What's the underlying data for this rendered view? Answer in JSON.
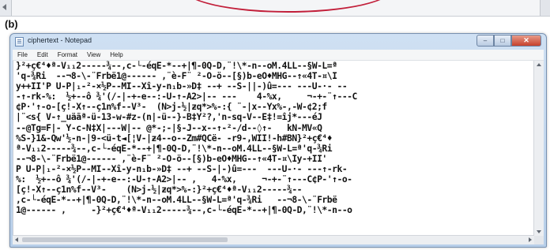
{
  "figure_label": "(b)",
  "window": {
    "title": "ciphertext - Notepad",
    "buttons": {
      "minimize": "–",
      "maximize": "□",
      "close": "✕"
    }
  },
  "menu": [
    "File",
    "Edit",
    "Format",
    "View",
    "Help"
  ],
  "content_lines": [
    "}²+ç€⁴♦ª-V₁₁2-----¾--,c-└-éqE-*--+|¶-0Q-D,¨!\\*-n--oM.4LL--§W-L=ª",
    "'q-¾Ri  --¬8-\\-¨Frbë1@------ ,¨è-F¨ ²-O-ö--[§)b-eO♦MHG--↑«4T-¤\\I",
    "y++II'P U-P|₁-²-×½P--MI--Xî-y-n₁b-»D‡ --+ --S-||-)û=--- ---U-·- --",
    "-↑-rk-%:  ½+--ô ¾'(/-|-+-e--:-U-↑-A2>|-- ---    4-%x,     ¬-+-¨↑---C",
    "¢P·'↑-o-[ç!-X↑--ç1n%f--V³-  (N>j-½|ƶq*>%-:{ ¨-|x--Yx%-,-W-¢2;f",
    "|¨<s{ V-↑_uäãª-ü-13-w-#z-(n|-ü--}-B‡Y²?,'n-sq-V--E‡!=îj*---éJ",
    "--@Tg=F|- Y-c-N‡X|---W|-- @*-;-|§-J--x--↑-²-/d--◊↑-   kN-MV«Q",
    "%S-}1&-Qw'½-n-|9-<ü-t◄[¦V-|ƶ4--o--Zm#QCë- -r9-,WII!-h#BN}²+ç€⁴♦",
    "ª-V₁₁2-----¾--,c-└-éqE-*--+|¶-0Q-D,¨!\\*-n--oM.4LL--§W-L=ª'q-¾Ri",
    "--¬8-\\-¨Frbë1@------ ,¨è-F¨ ²-O-ö--[§)b-eO♦MHG--↑«4T-¤\\Iy-+II'",
    "P U-P|₁-²-×½P--MI--Xî-y-n₁b-»D‡ --+ --S-|-)û=---  ---U-·- ---↑-rk-",
    "%:  ½+--ô ¾'(/-|-+-e--:-U-↑-A2>|-- ,   4-%x,     ¬-+-¨↑---C¢P-'↑-o-",
    "[ç!-X↑--ç1n%f--V³-    (N>j-½|ƶq*>%-:}²+ç€⁴♦ª-V₁₁2-----¾--",
    ",c-└-éqE-*--+|¶-0Q-D,¨!\\*-n--oM.4LL--§W-L=ª'q-¾Ri   --¬8-\\-¨Frbë",
    "1@------ ,     -}²+ç€⁴♦ª-V₁₁2-----¾--,c-└-éqE-*--+|¶-0Q-D,¨!\\*-n--o"
  ]
}
